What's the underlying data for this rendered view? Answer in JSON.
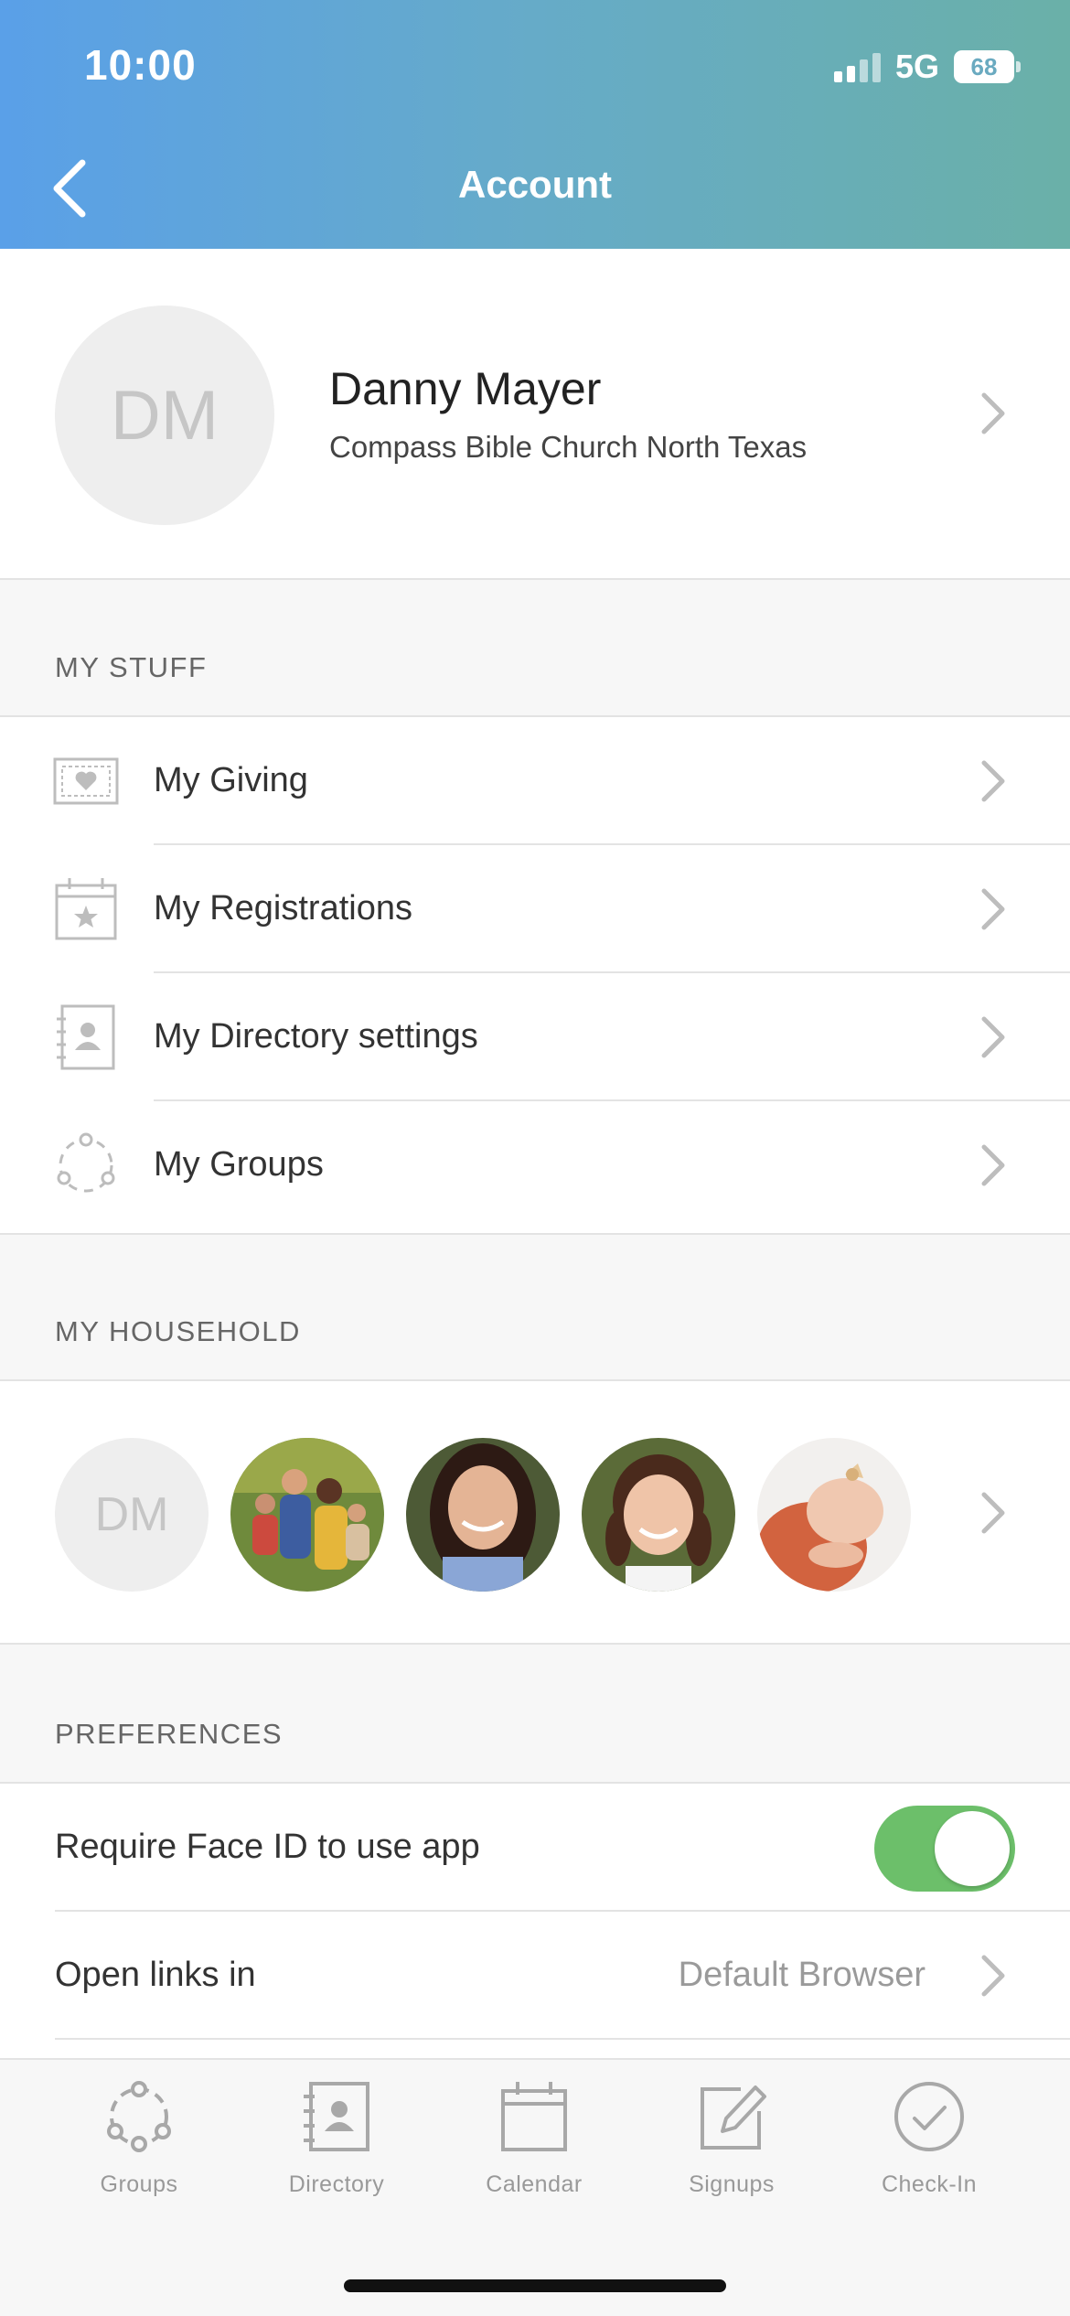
{
  "status_bar": {
    "time": "10:00",
    "network": "5G",
    "battery": "68"
  },
  "header": {
    "title": "Account",
    "back_icon": "chevron-left-icon"
  },
  "profile": {
    "initials": "DM",
    "name": "Danny Mayer",
    "organization": "Compass Bible Church North Texas"
  },
  "my_stuff": {
    "heading": "MY STUFF",
    "items": [
      {
        "label": "My Giving",
        "icon": "giving-icon"
      },
      {
        "label": "My Registrations",
        "icon": "registrations-calendar-icon"
      },
      {
        "label": "My Directory settings",
        "icon": "directory-icon"
      },
      {
        "label": "My Groups",
        "icon": "groups-icon"
      }
    ]
  },
  "household": {
    "heading": "MY HOUSEHOLD",
    "members": [
      {
        "initials": "DM",
        "type": "initials"
      },
      {
        "type": "photo",
        "icon": "family-photo"
      },
      {
        "type": "photo",
        "icon": "girl-photo"
      },
      {
        "type": "photo",
        "icon": "child-photo"
      },
      {
        "type": "photo",
        "icon": "baby-photo"
      }
    ]
  },
  "preferences": {
    "heading": "PREFERENCES",
    "face_id_label": "Require Face ID to use app",
    "face_id_enabled": true,
    "links_label": "Open links in",
    "links_value": "Default Browser"
  },
  "tabbar": {
    "tabs": [
      {
        "label": "Groups",
        "icon": "groups-icon"
      },
      {
        "label": "Directory",
        "icon": "directory-icon"
      },
      {
        "label": "Calendar",
        "icon": "calendar-icon"
      },
      {
        "label": "Signups",
        "icon": "signups-icon"
      },
      {
        "label": "Check-In",
        "icon": "checkin-icon"
      }
    ]
  },
  "colors": {
    "header_start": "#5aa0e8",
    "header_end": "#6ab0a8",
    "toggle_on": "#6cbf6a"
  }
}
